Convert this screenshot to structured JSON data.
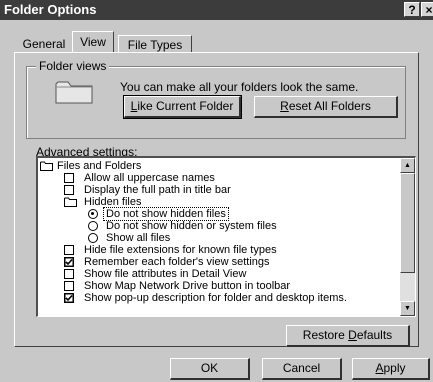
{
  "window": {
    "title": "Folder Options",
    "help_button": "?",
    "close_button": "×"
  },
  "tabs": [
    {
      "label": "General"
    },
    {
      "label": "View"
    },
    {
      "label": "File Types"
    }
  ],
  "folder_views": {
    "group_label": "Folder views",
    "description": "You can make all your folders look the same.",
    "like_current": {
      "accel": "L",
      "rest": "ike Current Folder"
    },
    "reset_all": {
      "accel": "R",
      "rest": "eset All Folders"
    }
  },
  "advanced": {
    "label": "Advanced settings:",
    "items": [
      {
        "kind": "folder",
        "label": "Files and Folders"
      },
      {
        "kind": "checkbox",
        "checked": false,
        "label": "Allow all uppercase names"
      },
      {
        "kind": "checkbox",
        "checked": false,
        "label": "Display the full path in title bar"
      },
      {
        "kind": "folder",
        "label": "Hidden files"
      },
      {
        "kind": "radio",
        "selected": true,
        "label": "Do not show hidden files"
      },
      {
        "kind": "radio",
        "selected": false,
        "label": "Do not show hidden or system files"
      },
      {
        "kind": "radio",
        "selected": false,
        "label": "Show all files"
      },
      {
        "kind": "checkbox",
        "checked": false,
        "label": "Hide file extensions for known file types"
      },
      {
        "kind": "checkbox",
        "checked": true,
        "label": "Remember each folder's view settings"
      },
      {
        "kind": "checkbox",
        "checked": false,
        "label": "Show file attributes in Detail View"
      },
      {
        "kind": "checkbox",
        "checked": false,
        "label": "Show Map Network Drive button in toolbar"
      },
      {
        "kind": "checkbox",
        "checked": true,
        "label": "Show pop-up description for folder and desktop items."
      }
    ]
  },
  "restore_defaults": {
    "before": "Restore ",
    "accel": "D",
    "rest": "efaults"
  },
  "footer": {
    "ok": "OK",
    "cancel": "Cancel",
    "apply": {
      "accel": "A",
      "rest": "pply"
    }
  },
  "colors": {
    "title_bar": "#3c3c3c",
    "face": "#c8c8c8",
    "list_background": "#ffffff"
  }
}
